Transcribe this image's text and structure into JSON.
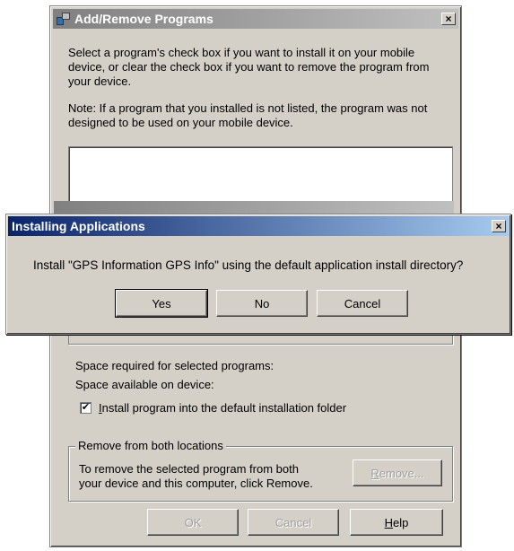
{
  "back_window": {
    "title": "Add/Remove Programs",
    "close_label": "×",
    "instructions": "Select a program's check box if you want to install it on your mobile device, or clear the check box if you want to remove the program from your device.",
    "note": "Note:  If a program that you installed is not listed, the program was not designed to be used on your mobile device.",
    "space_required_label": "Space required for selected programs:",
    "space_available_label": "Space available on device:",
    "install_default_checkbox": {
      "checked": true,
      "check_mark": "✔",
      "label_accesskey": "I",
      "label_rest": "nstall program into the default installation folder"
    },
    "remove_group": {
      "legend": "Remove from both locations",
      "text_line1": "To remove the selected program from both",
      "text_line2": "your device and this computer, click Remove.",
      "remove_button_accesskey": "R",
      "remove_button_rest": "emove..."
    },
    "buttons": {
      "ok": "OK",
      "cancel": "Cancel",
      "help_accesskey": "H",
      "help_rest": "elp"
    }
  },
  "dialog": {
    "title": "Installing Applications",
    "close_label": "×",
    "prompt": "Install \"GPS Information GPS Info\" using the default application install directory?",
    "buttons": {
      "yes": "Yes",
      "no": "No",
      "cancel": "Cancel"
    }
  },
  "colors": {
    "face": "#d4d0c8",
    "active_title_start": "#0a246a",
    "active_title_end": "#a6caf0",
    "inactive_title_start": "#808080",
    "inactive_title_end": "#c0c0c0"
  }
}
